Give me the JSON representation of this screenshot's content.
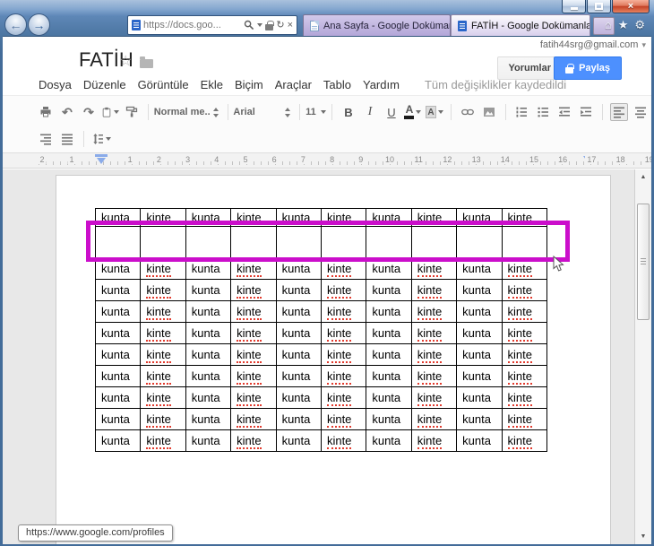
{
  "browser": {
    "address_bar": {
      "url": "https://docs.goo..."
    },
    "tabs": [
      {
        "title": "Ana Sayfa - Google Dokümanlar",
        "active": false
      },
      {
        "title": "FATİH - Google Dokümanlar",
        "active": true
      }
    ]
  },
  "glyphs": {
    "back": "←",
    "forward": "→",
    "refresh": "↻",
    "close": "×",
    "dropdown": "▾",
    "home": "⌂",
    "star": "★",
    "star_outline": "☆",
    "gear": "⚙",
    "undo": "↶",
    "redo": "↷",
    "scroll_up": "▲",
    "scroll_down": "▼"
  },
  "header": {
    "account_email": "fatih44srg@gmail.com",
    "doc_title": "FATİH",
    "comments_button": "Yorumlar",
    "share_button": "Paylaş",
    "menu_items": [
      "Dosya",
      "Düzenle",
      "Görüntüle",
      "Ekle",
      "Biçim",
      "Araçlar",
      "Tablo",
      "Yardım"
    ],
    "save_status": "Tüm değişiklikler kaydedildi"
  },
  "toolbar": {
    "style_name": "Normal me...",
    "font_name": "Arial",
    "font_size": "11",
    "bold": "B",
    "italic": "I",
    "underline": "U",
    "text_color": "A",
    "highlight_letter": "A"
  },
  "ruler": {
    "left_numbers": [
      "2",
      "1"
    ],
    "numbers": [
      "1",
      "2",
      "3",
      "4",
      "5",
      "6",
      "7",
      "8",
      "9",
      "10",
      "11",
      "12",
      "13",
      "14",
      "15",
      "16",
      "17",
      "18",
      "19"
    ]
  },
  "table": {
    "rows": [
      [
        "kunta",
        "kinte",
        "kunta",
        "kinte",
        "kunta",
        "kinte",
        "kunta",
        "kinte",
        "kunta",
        "kinte"
      ],
      [
        "",
        "",
        "",
        "",
        "",
        "",
        "",
        "",
        "",
        ""
      ],
      [
        "kunta",
        "kinte",
        "kunta",
        "kinte",
        "kunta",
        "kinte",
        "kunta",
        "kinte",
        "kunta",
        "kinte"
      ],
      [
        "kunta",
        "kinte",
        "kunta",
        "kinte",
        "kunta",
        "kinte",
        "kunta",
        "kinte",
        "kunta",
        "kinte"
      ],
      [
        "kunta",
        "kinte",
        "kunta",
        "kinte",
        "kunta",
        "kinte",
        "kunta",
        "kinte",
        "kunta",
        "kinte"
      ],
      [
        "kunta",
        "kinte",
        "kunta",
        "kinte",
        "kunta",
        "kinte",
        "kunta",
        "kinte",
        "kunta",
        "kinte"
      ],
      [
        "kunta",
        "kinte",
        "kunta",
        "kinte",
        "kunta",
        "kinte",
        "kunta",
        "kinte",
        "kunta",
        "kinte"
      ],
      [
        "kunta",
        "kinte",
        "kunta",
        "kinte",
        "kunta",
        "kinte",
        "kunta",
        "kinte",
        "kunta",
        "kinte"
      ],
      [
        "kunta",
        "kinte",
        "kunta",
        "kinte",
        "kunta",
        "kinte",
        "kunta",
        "kinte",
        "kunta",
        "kinte"
      ],
      [
        "kunta",
        "kinte",
        "kunta",
        "kinte",
        "kunta",
        "kinte",
        "kunta",
        "kinte",
        "kunta",
        "kinte"
      ],
      [
        "kunta",
        "kinte",
        "kunta",
        "kinte",
        "kunta",
        "kinte",
        "kunta",
        "kinte",
        "kunta",
        "kinte"
      ]
    ]
  },
  "status_tooltip": "https://www.google.com/profiles",
  "colors": {
    "highlight_box": "#cb0ecb",
    "share_button_bg": "#4d90fe",
    "misspell_underline": "#e23b2e",
    "tab_inactive_bg": "#c3b8e1"
  }
}
